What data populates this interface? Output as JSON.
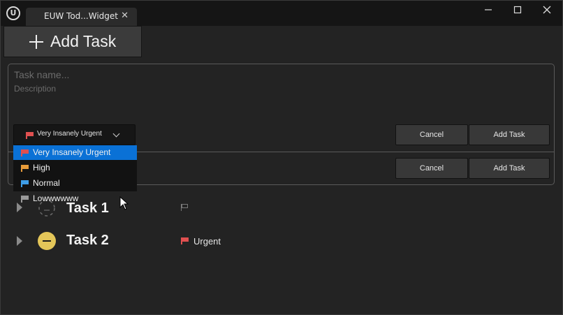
{
  "window": {
    "tab_title": "EUW Tod...Widget",
    "tab_close": "✕",
    "minimize": "—",
    "maximize": "☐",
    "close": "✕"
  },
  "toolbar": {
    "add_task_label": "Add Task"
  },
  "form": {
    "task_name_placeholder": "Task name...",
    "description_placeholder": "Description",
    "cancel_label": "Cancel",
    "add_task_label": "Add Task",
    "cancel_label_2": "Cancel",
    "add_task_label_2": "Add Task"
  },
  "priority": {
    "selected": "Very Insanely Urgent",
    "options": [
      {
        "label": "Very Insanely Urgent",
        "color": "#e05050"
      },
      {
        "label": "High",
        "color": "#e79b3a"
      },
      {
        "label": "Normal",
        "color": "#3f9ee8"
      },
      {
        "label": "Lowwwwww",
        "color": "#9a9a9a"
      }
    ]
  },
  "tasks": [
    {
      "title": "Task 1",
      "priority": ""
    },
    {
      "title": "Task 2",
      "priority": "Urgent",
      "flag_color": "#e05050"
    }
  ],
  "colors": {
    "accent": "#0a71d6",
    "status_yellow": "#e4c659"
  }
}
